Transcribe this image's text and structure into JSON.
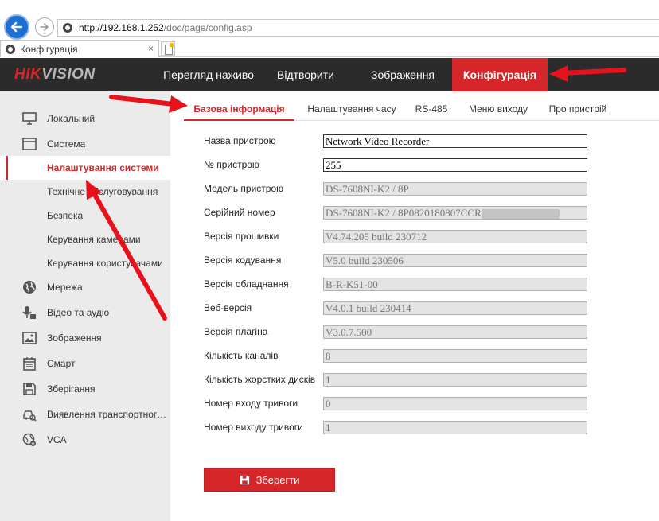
{
  "browser": {
    "address_host": "http://192.168.1.252",
    "address_path": "/doc/page/config.asp",
    "tab_title": "Конфігурація",
    "tab_close": "×"
  },
  "header": {
    "logo_part1": "HIK",
    "logo_part2": "VISION",
    "nav": [
      "Перегляд наживо",
      "Відтворити",
      "Зображення",
      "Конфігурація"
    ],
    "active_nav": "Конфігурація"
  },
  "sidebar": {
    "items": [
      {
        "label": "Локальний",
        "icon": "monitor-icon"
      },
      {
        "label": "Система",
        "icon": "system-window-icon"
      },
      {
        "label": "Налаштування системи",
        "icon": ""
      },
      {
        "label": "Технічне обслуговування",
        "icon": ""
      },
      {
        "label": "Безпека",
        "icon": ""
      },
      {
        "label": "Керування камерами",
        "icon": ""
      },
      {
        "label": "Керування користувачами",
        "icon": ""
      },
      {
        "label": "Мережа",
        "icon": "globe-icon"
      },
      {
        "label": "Відео та аудіо",
        "icon": "mic-video-icon"
      },
      {
        "label": "Зображення",
        "icon": "image-icon"
      },
      {
        "label": "Смарт",
        "icon": "calendar-icon"
      },
      {
        "label": "Зберігання",
        "icon": "floppy-icon"
      },
      {
        "label": "Виявлення транспортного засобу",
        "icon": "car-search-icon"
      },
      {
        "label": "VCA",
        "icon": "vca-icon"
      }
    ],
    "active_item": "Налаштування системи"
  },
  "subtabs": [
    "Базова інформація",
    "Налаштування часу",
    "RS-485",
    "Меню виходу",
    "Про пристрій"
  ],
  "active_subtab": "Базова інформація",
  "form": {
    "rows": [
      {
        "label": "Назва пристрою",
        "value": "Network Video Recorder",
        "editable": true
      },
      {
        "label": "№ пристрою",
        "value": "255",
        "editable": true
      },
      {
        "label": "Модель пристрою",
        "value": "DS-7608NI-K2 / 8P",
        "editable": false
      },
      {
        "label": "Серійний номер",
        "value": "DS-7608NI-K2 / 8P0820180807CCR",
        "editable": false
      },
      {
        "label": "Версія прошивки",
        "value": "V4.74.205 build 230712",
        "editable": false
      },
      {
        "label": "Версія кодування",
        "value": "V5.0 build 230506",
        "editable": false
      },
      {
        "label": "Версія обладнання",
        "value": "B-R-K51-00",
        "editable": false
      },
      {
        "label": "Веб-версія",
        "value": "V4.0.1 build 230414",
        "editable": false
      },
      {
        "label": "Версія плагіна",
        "value": "V3.0.7.500",
        "editable": false
      },
      {
        "label": "Кількість каналів",
        "value": "8",
        "editable": false
      },
      {
        "label": "Кількість жорстких дисків",
        "value": "1",
        "editable": false
      },
      {
        "label": "Номер входу тривоги",
        "value": "0",
        "editable": false
      },
      {
        "label": "Номер виходу тривоги",
        "value": "1",
        "editable": false
      }
    ]
  },
  "save_label": "Зберегти",
  "colors": {
    "accent": "#d6262a",
    "header_bg": "#2b2b2b",
    "sidebar_bg": "#ebebeb"
  }
}
